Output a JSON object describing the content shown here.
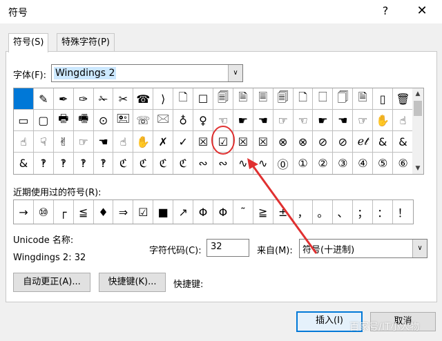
{
  "window": {
    "title": "符号",
    "help_icon": "?",
    "close_icon": "✕"
  },
  "tabs": [
    {
      "label": "符号(S)"
    },
    {
      "label": "特殊字符(P)"
    }
  ],
  "font": {
    "label": "字体(F):",
    "value": "Wingdings 2"
  },
  "symbol_grid": {
    "rows": [
      [
        "",
        "✎",
        "✒",
        "✑",
        "✁",
        "✂",
        "☎",
        "⟩",
        "🗋",
        "☐",
        "🗐",
        "🗎",
        "🗏",
        "🗐",
        "🗋",
        "🗌",
        "🗍",
        "🗎",
        "▯",
        "🗑"
      ],
      [
        "▭",
        "▢",
        "🖶",
        "🖷",
        "⊙",
        "🖭",
        "☏",
        "🖂",
        "♁",
        "♀",
        "☜",
        "☛",
        "☚",
        "☞",
        "☜",
        "☛",
        "☚",
        "☞",
        "✋",
        "☝"
      ],
      [
        "☝",
        "☟",
        "✌",
        "☞",
        "☚",
        "☝",
        "✋",
        "✗",
        "✓",
        "☒",
        "☑",
        "☒",
        "☒",
        "⊗",
        "⊗",
        "⊘",
        "⊘",
        "ℯ𝓉",
        "&",
        "&"
      ],
      [
        "&",
        "‽",
        "‽",
        "‽",
        "‽",
        "ℭ",
        "ℭ",
        "ℭ",
        "ℭ",
        "∾",
        "∾",
        "∿",
        "∿",
        "⓪",
        "①",
        "②",
        "③",
        "④",
        "⑤",
        "⑥"
      ]
    ]
  },
  "recent": {
    "label": "近期使用过的符号(R):",
    "symbols": [
      "→",
      "⑩",
      "┌",
      "≦",
      "♦",
      "⇒",
      "☑",
      "■",
      "↗",
      "Φ",
      "Φ",
      "˜",
      "≧",
      "±",
      "，",
      "。",
      "、",
      "；",
      "：",
      "！"
    ]
  },
  "unicode_name": {
    "label": "Unicode 名称:",
    "value": "Wingdings 2: 32"
  },
  "char_code": {
    "label": "字符代码(C):",
    "value": "32"
  },
  "from": {
    "label": "来自(M):",
    "value": "符号(十进制)"
  },
  "buttons": {
    "autocorrect": "自动更正(A)...",
    "shortcut_key": "快捷键(K)...",
    "shortcut_label": "快捷键:",
    "insert": "插入(I)",
    "cancel": "取消"
  },
  "watermark": "百家号/IT小人物",
  "annotation_color": "#e03030"
}
